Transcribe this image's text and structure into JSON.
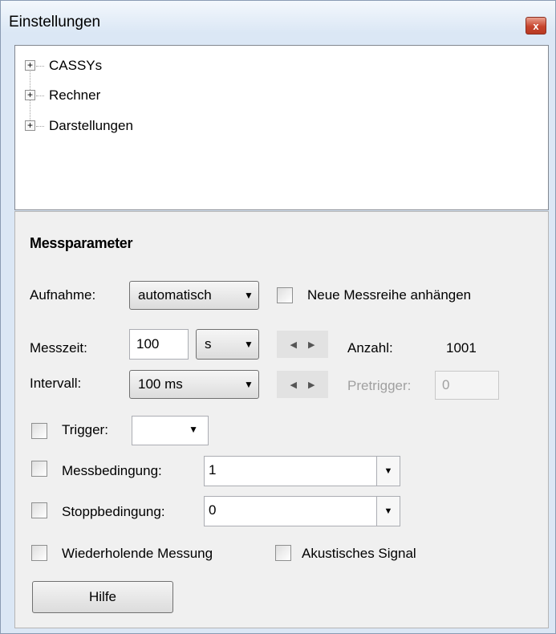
{
  "window": {
    "title": "Einstellungen",
    "close_glyph": "x"
  },
  "tree": {
    "items": [
      {
        "label": "CASSYs",
        "expander": "+"
      },
      {
        "label": "Rechner",
        "expander": "+"
      },
      {
        "label": "Darstellungen",
        "expander": "+"
      }
    ]
  },
  "params": {
    "section_title": "Messparameter",
    "aufnahme": {
      "label": "Aufnahme:",
      "value": "automatisch",
      "arrow": "▼"
    },
    "append": {
      "label": "Neue Messreihe anhängen",
      "checked": false
    },
    "messzeit": {
      "label": "Messzeit:",
      "value": "100",
      "unit": "s",
      "arrow": "▼"
    },
    "anzahl": {
      "label": "Anzahl:",
      "value": "1001"
    },
    "intervall": {
      "label": "Intervall:",
      "value": "100 ms",
      "arrow": "▼"
    },
    "spin_left": "◀",
    "spin_right": "▶",
    "pretrigger": {
      "label": "Pretrigger:",
      "value": "0",
      "disabled": true
    },
    "trigger": {
      "label": "Trigger:",
      "value": "",
      "arrow": "▼",
      "checked": false
    },
    "messbedingung": {
      "label": "Messbedingung:",
      "value": "1",
      "arrow": "▼",
      "checked": false
    },
    "stoppbedingung": {
      "label": "Stoppbedingung:",
      "value": "0",
      "arrow": "▼",
      "checked": false
    },
    "repeat": {
      "label": "Wiederholende Messung",
      "checked": false
    },
    "acoustic": {
      "label": "Akustisches Signal",
      "checked": false
    },
    "help_button": "Hilfe"
  }
}
